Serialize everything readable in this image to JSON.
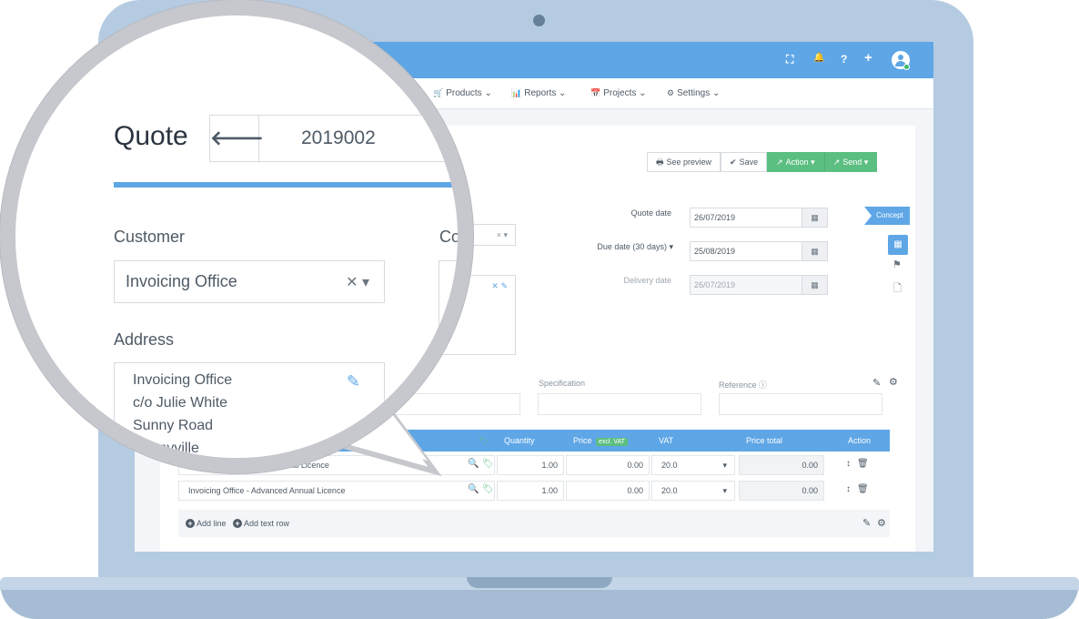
{
  "topbar": {
    "icons": [
      "fullscreen-icon",
      "bell-icon",
      "help-icon",
      "plus-icon",
      "user-avatar-icon"
    ],
    "glyphs": {
      "fullscreen": "⛶",
      "bell": "🔔",
      "help": "?",
      "plus": "+"
    }
  },
  "nav": {
    "items": [
      {
        "label": "Products",
        "icon": "cart-icon"
      },
      {
        "label": "Reports",
        "icon": "bar-chart-icon"
      },
      {
        "label": "Projects",
        "icon": "calendar-icon"
      },
      {
        "label": "Settings",
        "icon": "gear-icon"
      }
    ]
  },
  "toolbar": {
    "preview_label": "See preview",
    "save_label": "Save",
    "action_label": "Action",
    "send_label": "Send"
  },
  "dates": {
    "quote_label": "Quote date",
    "quote_value": "26/07/2019",
    "due_label": "Due date (30 days)",
    "due_value": "25/08/2019",
    "delivery_label": "Delivery date",
    "delivery_value": "26/07/2019"
  },
  "status": {
    "label": "Concept"
  },
  "fields": {
    "specification_label": "Specification",
    "reference_label": "Reference"
  },
  "table": {
    "headers": {
      "quantity": "Quantity",
      "price": "Price",
      "price_badge": "excl. VAT",
      "vat": "VAT",
      "price_total": "Price total",
      "action": "Action"
    },
    "rows": [
      {
        "product": "Invoicing Office - Basic Annual Licence",
        "quantity": "1.00",
        "price": "0.00",
        "vat": "20.0",
        "total": "0.00"
      },
      {
        "product": "Invoicing Office - Advanced Annual Licence",
        "quantity": "1.00",
        "price": "0.00",
        "vat": "20.0",
        "total": "0.00"
      }
    ],
    "add_line": "Add line",
    "add_text_row": "Add text row"
  },
  "magnified": {
    "title": "Quote",
    "number": "2019002",
    "customer_label": "Customer",
    "customer_value": "Invoicing Office",
    "contact_label_partial": "Co",
    "address_label": "Address",
    "address_lines": [
      "Invoicing Office",
      "c/o Julie White",
      "Sunny Road",
      "Sunnyville"
    ]
  },
  "colors": {
    "primary": "#5ea6e6",
    "success": "#5cbf82",
    "laptop": "#b4cbe2",
    "magnifier_ring": "#c6c8cd"
  }
}
